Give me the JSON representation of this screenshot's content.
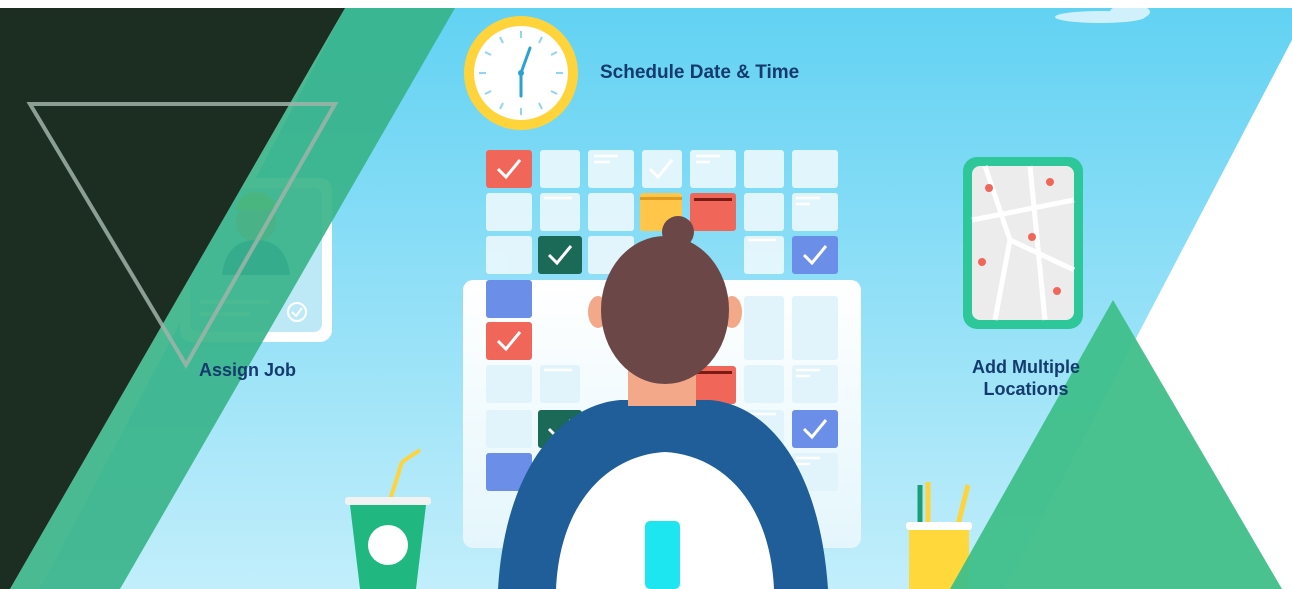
{
  "labels": {
    "schedule": "Schedule  Date & Time",
    "assign_job": "Assign Job",
    "add_locations": "Add Multiple Locations"
  },
  "colors": {
    "sky_top": "#5fd0f2",
    "sky_bottom": "#b8ecfa",
    "dark_panel": "#1c2e22",
    "green_panel": "#3bb489",
    "green_triangle": "#3fbf8a",
    "label_text": "#143a6e",
    "red_tile": "#f0675a",
    "dark_green_tile": "#1b6a58",
    "blue_tile": "#6b8fe8",
    "yellow_tile": "#ffc64a",
    "hair": "#6b4847",
    "shirt": "#1f5e98",
    "clock_face": "#ffd43b"
  },
  "icons": [
    "clock-icon",
    "worker-card-icon",
    "map-pin-icon",
    "checkmark-icon",
    "drink-cup-icon",
    "pencil-cup-icon"
  ]
}
